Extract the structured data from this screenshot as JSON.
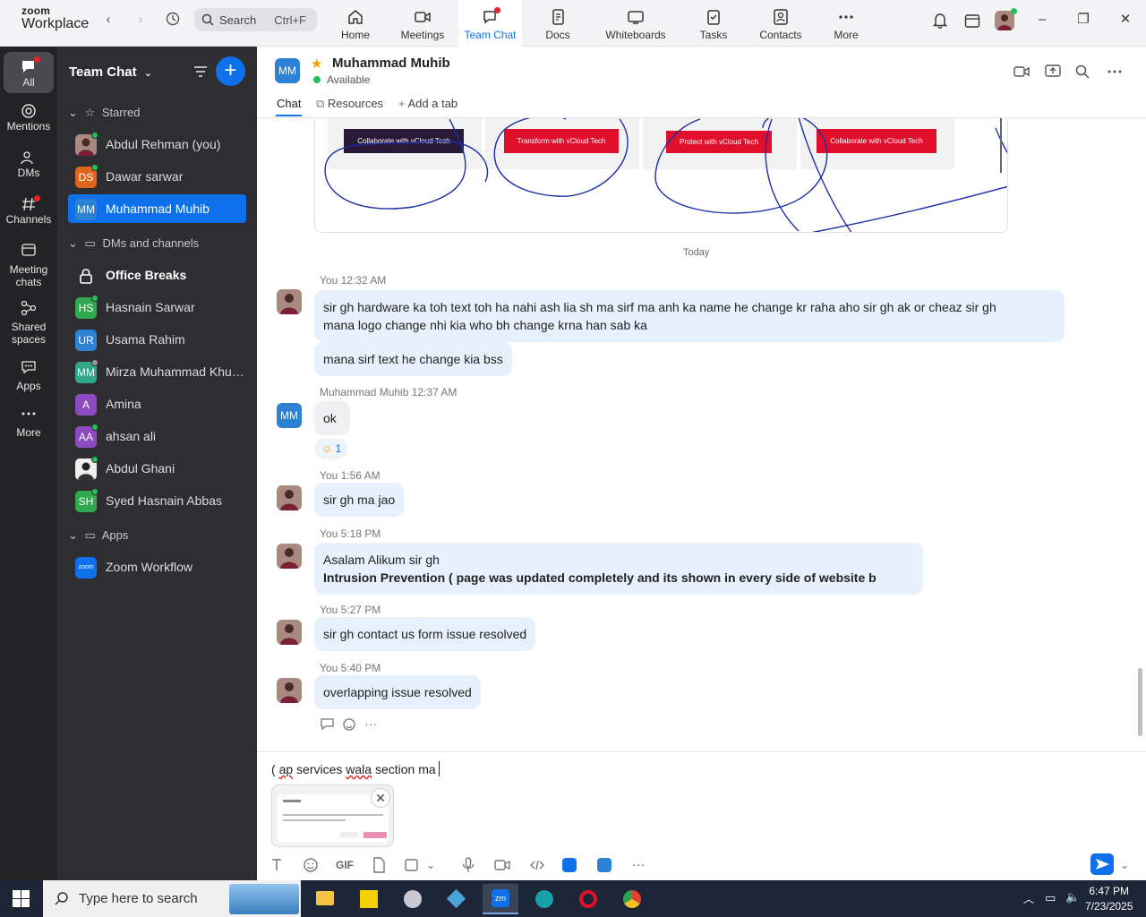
{
  "app": {
    "logo_line1": "zoom",
    "logo_line2": "Workplace",
    "search_label": "Search",
    "search_shortcut": "Ctrl+F"
  },
  "nav_tabs": [
    {
      "label": "Home",
      "icon": "home-icon"
    },
    {
      "label": "Meetings",
      "icon": "video-camera-icon"
    },
    {
      "label": "Team Chat",
      "icon": "chat-bubble-icon",
      "active": true
    },
    {
      "label": "Docs",
      "icon": "document-icon"
    },
    {
      "label": "Whiteboards",
      "icon": "whiteboard-icon"
    },
    {
      "label": "Tasks",
      "icon": "clipboard-icon"
    },
    {
      "label": "Contacts",
      "icon": "contact-card-icon"
    },
    {
      "label": "More",
      "icon": "more-horizontal-icon"
    }
  ],
  "rail": [
    {
      "label": "All",
      "icon": "chat-bubble-icon",
      "active": true
    },
    {
      "label": "Mentions",
      "icon": "at-sign-icon"
    },
    {
      "label": "DMs",
      "icon": "people-icon"
    },
    {
      "label": "Channels",
      "icon": "hash-icon"
    },
    {
      "label": "Meeting",
      "label2": "chats",
      "icon": "calendar-chat-icon"
    },
    {
      "label": "Shared",
      "label2": "spaces",
      "icon": "shared-nodes-icon"
    },
    {
      "label": "Apps",
      "icon": "apps-chat-icon"
    },
    {
      "label": "More",
      "icon": "more-horizontal-icon"
    }
  ],
  "sidebar": {
    "title": "Team Chat",
    "sections": {
      "starred": "Starred",
      "dms": "DMs and channels",
      "apps": "Apps"
    },
    "starred": [
      {
        "name": "Abdul Rehman (you)",
        "initials": "",
        "color": "#8b5a5a",
        "photo": true,
        "presence": true
      },
      {
        "name": "Dawar sarwar",
        "initials": "DS",
        "color": "#e0651c",
        "presence": true
      },
      {
        "name": "Muhammad Muhib",
        "initials": "MM",
        "color": "#2d82d6",
        "presence": false,
        "active": true
      }
    ],
    "dms": [
      {
        "name": "Office Breaks",
        "icon": "lock-icon",
        "bold": true
      },
      {
        "name": "Hasnain Sarwar",
        "initials": "HS",
        "color": "#2fa84f",
        "presence": true
      },
      {
        "name": "Usama Rahim",
        "initials": "UR",
        "color": "#2d82d6",
        "presence": false
      },
      {
        "name": "Mirza Muhammad Khur...",
        "initials": "MM",
        "color": "#2fa88a",
        "presence": true
      },
      {
        "name": "Amina",
        "initials": "A",
        "color": "#8e4ac0",
        "presence": false
      },
      {
        "name": "ahsan ali",
        "initials": "AA",
        "color": "#8e4ac0",
        "presence": true
      },
      {
        "name": "Abdul Ghani",
        "initials": "",
        "color": "#dddddd",
        "photo": true,
        "presence": true
      },
      {
        "name": "Syed Hasnain Abbas",
        "initials": "SH",
        "color": "#2fa84f",
        "presence": true
      }
    ],
    "apps": [
      {
        "name": "Zoom Workflow",
        "initials": "zoom",
        "color": "#0e71eb"
      }
    ]
  },
  "chat_header": {
    "initials": "MM",
    "name": "Muhammad Muhib",
    "status": "Available",
    "tabs": [
      "Chat",
      "Resources",
      "Add a tab"
    ]
  },
  "shared_image": {
    "buttons": [
      "Collaborate with vCloud Tech",
      "Transform with vCloud Tech",
      "Protect with vCloud Tech",
      "Collaborate with vCloud Tech"
    ]
  },
  "day_divider": "Today",
  "messages": [
    {
      "sender": "You",
      "time": "12:32 AM",
      "lines": [
        "sir gh hardware ka toh text toh ha nahi ash lia sh ma sirf ma anh ka name he change kr raha aho sir gh ak or cheaz  sir gh",
        "mana logo change nhi kia who bh change krna han sab ka"
      ]
    },
    {
      "sender": "",
      "time": "",
      "lines": [
        "mana sirf text he change kia bss"
      ]
    },
    {
      "sender": "Muhammad Muhib",
      "time": "12:37 AM",
      "lines": [
        "ok"
      ],
      "reaction": "1"
    },
    {
      "sender": "You",
      "time": "1:56 AM",
      "lines": [
        "sir gh ma jao"
      ]
    },
    {
      "sender": "You",
      "time": "5:18 PM",
      "lines": [
        "Asalam Alikum sir gh",
        "Intrusion Prevention ( page was  updated completely and its  shown in every side of website b"
      ]
    },
    {
      "sender": "You",
      "time": "5:27 PM",
      "lines": [
        "sir gh contact us form issue resolved"
      ]
    },
    {
      "sender": "You",
      "time": "5:40 PM",
      "lines": [
        "overlapping issue resolved"
      ]
    }
  ],
  "composer": {
    "text_prefix": "( ",
    "text_wavy1": "ap",
    "text_mid": " services ",
    "text_wavy2": "wala",
    "text_suffix": " section ma",
    "toolbar_gif": "GIF"
  },
  "taskbar": {
    "search_placeholder": "Type here to search",
    "time": "6:47 PM",
    "date": "7/23/2025"
  },
  "colors": {
    "accent": "#0e71eb",
    "sidebar_bg": "#2e2e32",
    "rail_bg": "#232326",
    "bubble_bg": "#e6f1fd",
    "presence": "#21c15a",
    "notification": "#e02828"
  }
}
